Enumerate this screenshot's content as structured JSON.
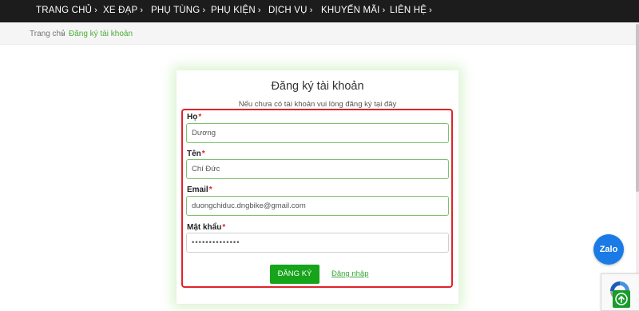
{
  "nav": {
    "items": [
      {
        "label": "TRANG CHỦ"
      },
      {
        "label": "XE ĐẠP"
      },
      {
        "label": "PHỤ TÙNG"
      },
      {
        "label": "PHỤ KIỆN"
      },
      {
        "label": "DỊCH VỤ"
      },
      {
        "label": "KHUYẾN MÃI"
      },
      {
        "label": "LIÊN HỆ"
      }
    ],
    "chevron": "›"
  },
  "breadcrumb": {
    "home": "Trang chủ",
    "separator": "›",
    "current": "Đăng ký tài khoản"
  },
  "form": {
    "title": "Đăng ký tài khoản",
    "subtitle": "Nếu chưa có tài khoản vui lòng đăng ký tại đây",
    "required_mark": "*",
    "fields": [
      {
        "label": "Họ",
        "value": "Dương"
      },
      {
        "label": "Tên",
        "value": "Chí Đức"
      },
      {
        "label": "Email",
        "value": "duongchiduc.dngbike@gmail.com"
      },
      {
        "label": "Mật khẩu",
        "value": "••••••••••••••"
      }
    ],
    "submit_label": "ĐĂNG KÝ",
    "login_link": "Đăng nhập"
  },
  "widgets": {
    "zalo_label": "Zalo",
    "zalo_color": "#1a7be6",
    "backtop_icon": "arrow-up-icon",
    "recaptcha_icon": "recaptcha-icon"
  },
  "colors": {
    "nav_bg": "#1c1c1c",
    "accent_green": "#16a41a",
    "highlight_red": "#e0232a"
  }
}
